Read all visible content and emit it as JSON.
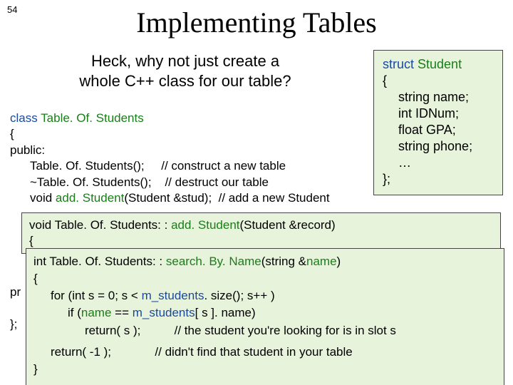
{
  "page_number": "54",
  "title": "Implementing Tables",
  "subtitle_l1": "Heck, why not just create a",
  "subtitle_l2": "whole C++ class for our table?",
  "struct": {
    "l1a": "struct ",
    "l1b": "Student",
    "l2": "{",
    "l3": "string name;",
    "l4": "int IDNum;",
    "l5": "float GPA;",
    "l6": "string phone;",
    "l7": "…",
    "l8": "};"
  },
  "main": {
    "l1a": "class ",
    "l1b": "Table. Of. Students",
    "l2": "{",
    "l3": "public:",
    "l4a": "Table. Of. Students();",
    "l4b": "     // construct a new table",
    "l5a": "~Table. Of. Students();",
    "l5b": "    // destruct our table",
    "l6a": "void ",
    "l6b": "add. Student",
    "l6c": "(Student &stud);  // add a new Student",
    "pr": "pr",
    "brace": "};"
  },
  "ov1": {
    "l1a": "void Table. Of. Students: : ",
    "l1b": "add. Student",
    "l1c": "(Student &record)",
    "l2": "{"
  },
  "ov2": {
    "l1a": "int Table. Of. Students: : ",
    "l1b": "search. By. Name",
    "l1c": "(string &",
    "l1d": "name",
    "l1e": ")",
    "l2": "{",
    "l3a": "for (int s = 0; s < ",
    "l3b": "m_students",
    "l3c": ". size(); s++ )",
    "l4a": "if (",
    "l4b": "name",
    "l4c": " == ",
    "l4d": "m_students",
    "l4e": "[ s ]. name)",
    "l5a": "return( s );",
    "l5b": "          // the student you're looking for is in slot s",
    "l6a": "return( -1 );",
    "l6b": "             // didn't find that student in your table",
    "l7": "}"
  }
}
